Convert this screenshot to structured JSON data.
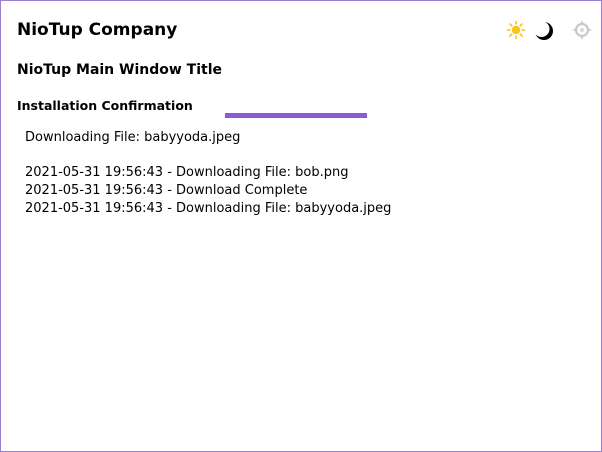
{
  "header": {
    "company": "NioTup Company",
    "theme_icons": [
      {
        "name": "sun-icon",
        "color": "#f5c518"
      },
      {
        "name": "moon-icon",
        "color": "#000000"
      },
      {
        "name": "auto-theme-icon",
        "color": "#bdbdbd"
      }
    ]
  },
  "window": {
    "title": "NioTup Main Window Title"
  },
  "install": {
    "section_title": "Installation Confirmation",
    "progress_fraction": 1.0,
    "accent_color": "#8a5bd6",
    "current_status": "Downloading File: babyyoda.jpeg",
    "log": [
      "2021-05-31 19:56:43 - Downloading File: bob.png",
      "2021-05-31 19:56:43 - Download Complete",
      "2021-05-31 19:56:43 - Downloading File: babyyoda.jpeg"
    ]
  }
}
